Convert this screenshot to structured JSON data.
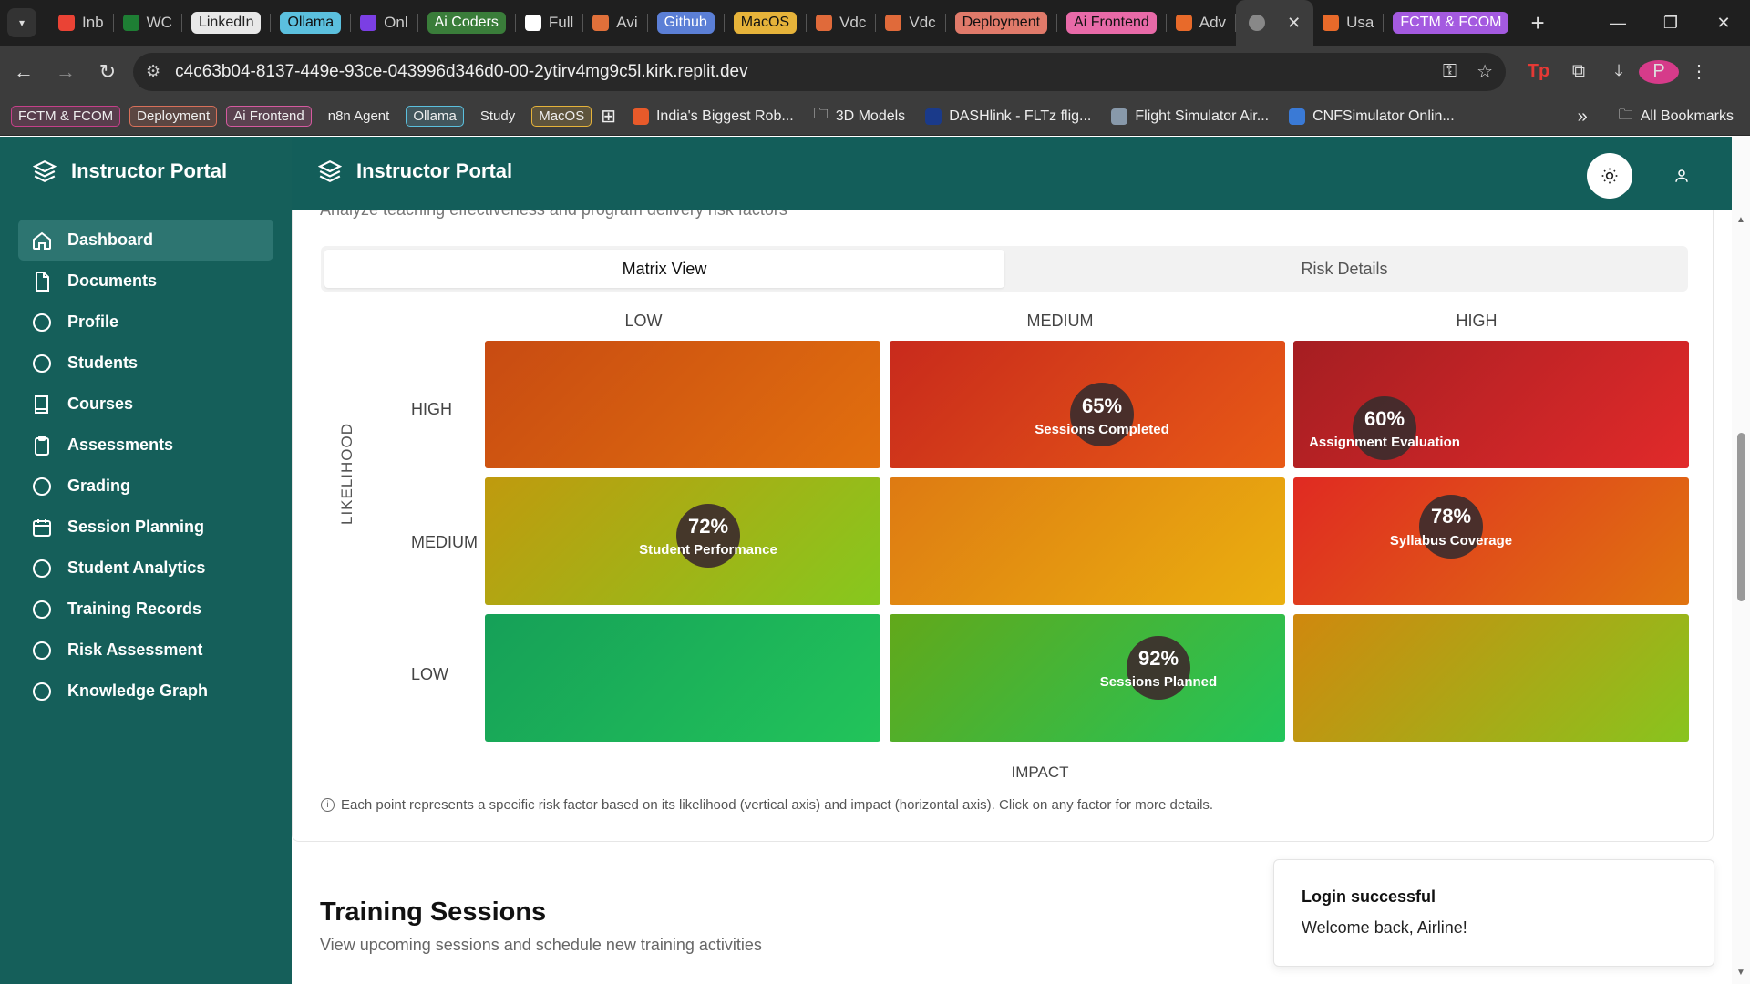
{
  "browser": {
    "tabs": [
      {
        "label": "Inb",
        "color": "#ea4335"
      },
      {
        "label": "WC",
        "color": "#1e7e34"
      },
      {
        "label": "LinkedIn",
        "pill": "#e8e8e8",
        "text": "#222"
      },
      {
        "label": "Ollama",
        "pill": "#5bc0de",
        "text": "#111"
      },
      {
        "label": "Onl",
        "color": "#7b3fe4"
      },
      {
        "label": "Ai Coders",
        "pill": "#3a7d3a",
        "text": "#fff"
      },
      {
        "label": "Full",
        "color": "#ffffff"
      },
      {
        "label": "Avi",
        "color": "#e0703a"
      },
      {
        "label": "Github",
        "pill": "#5b7fd6",
        "text": "#fff"
      },
      {
        "label": "MacOS",
        "pill": "#e6b33a",
        "text": "#111"
      },
      {
        "label": "Vdc",
        "color": "#e06a3a"
      },
      {
        "label": "Vdc",
        "color": "#e06a3a"
      },
      {
        "label": "Deployment",
        "pill": "#e07a6a",
        "text": "#111"
      },
      {
        "label": "Ai Frontend",
        "pill": "#e86aa8",
        "text": "#111"
      },
      {
        "label": "Adv",
        "color": "#e86a2a"
      }
    ],
    "active_tab_close": "✕",
    "after_tabs": [
      {
        "label": "Usa",
        "color": "#e86a2a"
      },
      {
        "label": "FCTM & FCOM",
        "pill": "#a45ae0",
        "text": "#fff"
      }
    ],
    "url": "c4c63b04-8137-449e-93ce-043996d346d0-00-2ytirv4mg9c5l.kirk.replit.dev",
    "profile_initial": "P",
    "bookmarks": [
      {
        "label": "FCTM & FCOM",
        "chip": "#c6408a"
      },
      {
        "label": "Deployment",
        "chip": "#d9705a"
      },
      {
        "label": "Ai Frontend",
        "chip": "#d65aa0"
      },
      {
        "label": "n8n Agent",
        "chip": "#3c3c3c"
      },
      {
        "label": "Ollama",
        "chip": "#5bc0de"
      },
      {
        "label": "Study",
        "chip": "#3c3c3c"
      },
      {
        "label": "MacOS",
        "chip": "#e6b33a"
      }
    ],
    "bookmark_links": [
      {
        "label": "India's Biggest Rob...",
        "icon": "#e85a2a"
      },
      {
        "label": "3D Models",
        "icon": "folder"
      },
      {
        "label": "DASHlink - FLTz flig...",
        "icon": "#1a3a8a"
      },
      {
        "label": "Flight Simulator Air...",
        "icon": "#8899aa"
      },
      {
        "label": "CNFSimulator Onlin...",
        "icon": "#3a7ad6"
      }
    ],
    "all_bookmarks": "All Bookmarks"
  },
  "app": {
    "brand": "Instructor Portal",
    "header_title": "Instructor Portal",
    "nav": [
      {
        "label": "Dashboard",
        "icon": "home-icon",
        "active": true
      },
      {
        "label": "Documents",
        "icon": "document-icon"
      },
      {
        "label": "Profile",
        "icon": "circle-icon"
      },
      {
        "label": "Students",
        "icon": "circle-icon"
      },
      {
        "label": "Courses",
        "icon": "book-icon"
      },
      {
        "label": "Assessments",
        "icon": "clipboard-icon"
      },
      {
        "label": "Grading",
        "icon": "circle-icon"
      },
      {
        "label": "Session Planning",
        "icon": "calendar-icon"
      },
      {
        "label": "Student Analytics",
        "icon": "circle-icon"
      },
      {
        "label": "Training Records",
        "icon": "circle-icon"
      },
      {
        "label": "Risk Assessment",
        "icon": "circle-icon"
      },
      {
        "label": "Knowledge Graph",
        "icon": "circle-icon"
      }
    ],
    "section_cut_text": "Analyze teaching effectiveness and program delivery risk factors",
    "tabs": [
      "Matrix View",
      "Risk Details"
    ],
    "active_tab": "Matrix View",
    "matrix": {
      "impact_labels": [
        "LOW",
        "MEDIUM",
        "HIGH"
      ],
      "likelihood_labels": [
        "HIGH",
        "MEDIUM",
        "LOW"
      ],
      "y_axis": "LIKELIHOOD",
      "x_axis": "IMPACT",
      "factors": [
        {
          "pct": "65%",
          "label": "Sessions Completed",
          "likelihood": "HIGH",
          "impact": "MEDIUM"
        },
        {
          "pct": "60%",
          "label": "Assignment Evaluation",
          "likelihood": "HIGH",
          "impact": "HIGH"
        },
        {
          "pct": "72%",
          "label": "Student Performance",
          "likelihood": "MEDIUM",
          "impact": "LOW"
        },
        {
          "pct": "78%",
          "label": "Syllabus Coverage",
          "likelihood": "MEDIUM",
          "impact": "HIGH"
        },
        {
          "pct": "92%",
          "label": "Sessions Planned",
          "likelihood": "LOW",
          "impact": "MEDIUM"
        }
      ],
      "footnote": "Each point represents a specific risk factor based on its likelihood (vertical axis) and impact (horizontal axis). Click on any factor for more details."
    },
    "training": {
      "title": "Training Sessions",
      "subtitle": "View upcoming sessions and schedule new training activities"
    },
    "toast": {
      "title": "Login successful",
      "message": "Welcome back, Airline!"
    },
    "colors": {
      "sidebar": "#155f5a",
      "topbar": "#135e5a",
      "active_nav": "#2d7571"
    }
  }
}
